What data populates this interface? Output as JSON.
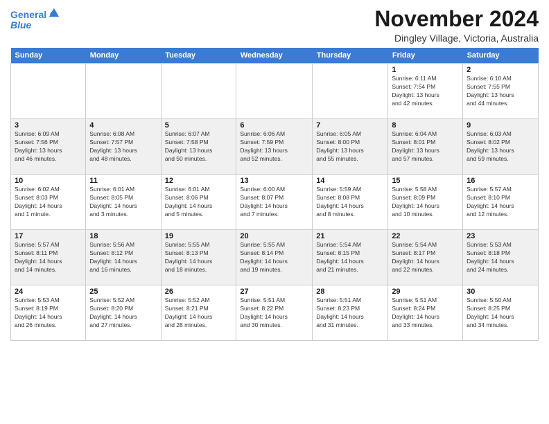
{
  "header": {
    "logo_line1": "General",
    "logo_line2": "Blue",
    "month_title": "November 2024",
    "location": "Dingley Village, Victoria, Australia"
  },
  "weekdays": [
    "Sunday",
    "Monday",
    "Tuesday",
    "Wednesday",
    "Thursday",
    "Friday",
    "Saturday"
  ],
  "weeks": [
    [
      {
        "day": "",
        "info": ""
      },
      {
        "day": "",
        "info": ""
      },
      {
        "day": "",
        "info": ""
      },
      {
        "day": "",
        "info": ""
      },
      {
        "day": "",
        "info": ""
      },
      {
        "day": "1",
        "info": "Sunrise: 6:11 AM\nSunset: 7:54 PM\nDaylight: 13 hours\nand 42 minutes."
      },
      {
        "day": "2",
        "info": "Sunrise: 6:10 AM\nSunset: 7:55 PM\nDaylight: 13 hours\nand 44 minutes."
      }
    ],
    [
      {
        "day": "3",
        "info": "Sunrise: 6:09 AM\nSunset: 7:56 PM\nDaylight: 13 hours\nand 46 minutes."
      },
      {
        "day": "4",
        "info": "Sunrise: 6:08 AM\nSunset: 7:57 PM\nDaylight: 13 hours\nand 48 minutes."
      },
      {
        "day": "5",
        "info": "Sunrise: 6:07 AM\nSunset: 7:58 PM\nDaylight: 13 hours\nand 50 minutes."
      },
      {
        "day": "6",
        "info": "Sunrise: 6:06 AM\nSunset: 7:59 PM\nDaylight: 13 hours\nand 52 minutes."
      },
      {
        "day": "7",
        "info": "Sunrise: 6:05 AM\nSunset: 8:00 PM\nDaylight: 13 hours\nand 55 minutes."
      },
      {
        "day": "8",
        "info": "Sunrise: 6:04 AM\nSunset: 8:01 PM\nDaylight: 13 hours\nand 57 minutes."
      },
      {
        "day": "9",
        "info": "Sunrise: 6:03 AM\nSunset: 8:02 PM\nDaylight: 13 hours\nand 59 minutes."
      }
    ],
    [
      {
        "day": "10",
        "info": "Sunrise: 6:02 AM\nSunset: 8:03 PM\nDaylight: 14 hours\nand 1 minute."
      },
      {
        "day": "11",
        "info": "Sunrise: 6:01 AM\nSunset: 8:05 PM\nDaylight: 14 hours\nand 3 minutes."
      },
      {
        "day": "12",
        "info": "Sunrise: 6:01 AM\nSunset: 8:06 PM\nDaylight: 14 hours\nand 5 minutes."
      },
      {
        "day": "13",
        "info": "Sunrise: 6:00 AM\nSunset: 8:07 PM\nDaylight: 14 hours\nand 7 minutes."
      },
      {
        "day": "14",
        "info": "Sunrise: 5:59 AM\nSunset: 8:08 PM\nDaylight: 14 hours\nand 8 minutes."
      },
      {
        "day": "15",
        "info": "Sunrise: 5:58 AM\nSunset: 8:09 PM\nDaylight: 14 hours\nand 10 minutes."
      },
      {
        "day": "16",
        "info": "Sunrise: 5:57 AM\nSunset: 8:10 PM\nDaylight: 14 hours\nand 12 minutes."
      }
    ],
    [
      {
        "day": "17",
        "info": "Sunrise: 5:57 AM\nSunset: 8:11 PM\nDaylight: 14 hours\nand 14 minutes."
      },
      {
        "day": "18",
        "info": "Sunrise: 5:56 AM\nSunset: 8:12 PM\nDaylight: 14 hours\nand 16 minutes."
      },
      {
        "day": "19",
        "info": "Sunrise: 5:55 AM\nSunset: 8:13 PM\nDaylight: 14 hours\nand 18 minutes."
      },
      {
        "day": "20",
        "info": "Sunrise: 5:55 AM\nSunset: 8:14 PM\nDaylight: 14 hours\nand 19 minutes."
      },
      {
        "day": "21",
        "info": "Sunrise: 5:54 AM\nSunset: 8:15 PM\nDaylight: 14 hours\nand 21 minutes."
      },
      {
        "day": "22",
        "info": "Sunrise: 5:54 AM\nSunset: 8:17 PM\nDaylight: 14 hours\nand 22 minutes."
      },
      {
        "day": "23",
        "info": "Sunrise: 5:53 AM\nSunset: 8:18 PM\nDaylight: 14 hours\nand 24 minutes."
      }
    ],
    [
      {
        "day": "24",
        "info": "Sunrise: 5:53 AM\nSunset: 8:19 PM\nDaylight: 14 hours\nand 26 minutes."
      },
      {
        "day": "25",
        "info": "Sunrise: 5:52 AM\nSunset: 8:20 PM\nDaylight: 14 hours\nand 27 minutes."
      },
      {
        "day": "26",
        "info": "Sunrise: 5:52 AM\nSunset: 8:21 PM\nDaylight: 14 hours\nand 28 minutes."
      },
      {
        "day": "27",
        "info": "Sunrise: 5:51 AM\nSunset: 8:22 PM\nDaylight: 14 hours\nand 30 minutes."
      },
      {
        "day": "28",
        "info": "Sunrise: 5:51 AM\nSunset: 8:23 PM\nDaylight: 14 hours\nand 31 minutes."
      },
      {
        "day": "29",
        "info": "Sunrise: 5:51 AM\nSunset: 8:24 PM\nDaylight: 14 hours\nand 33 minutes."
      },
      {
        "day": "30",
        "info": "Sunrise: 5:50 AM\nSunset: 8:25 PM\nDaylight: 14 hours\nand 34 minutes."
      }
    ]
  ]
}
